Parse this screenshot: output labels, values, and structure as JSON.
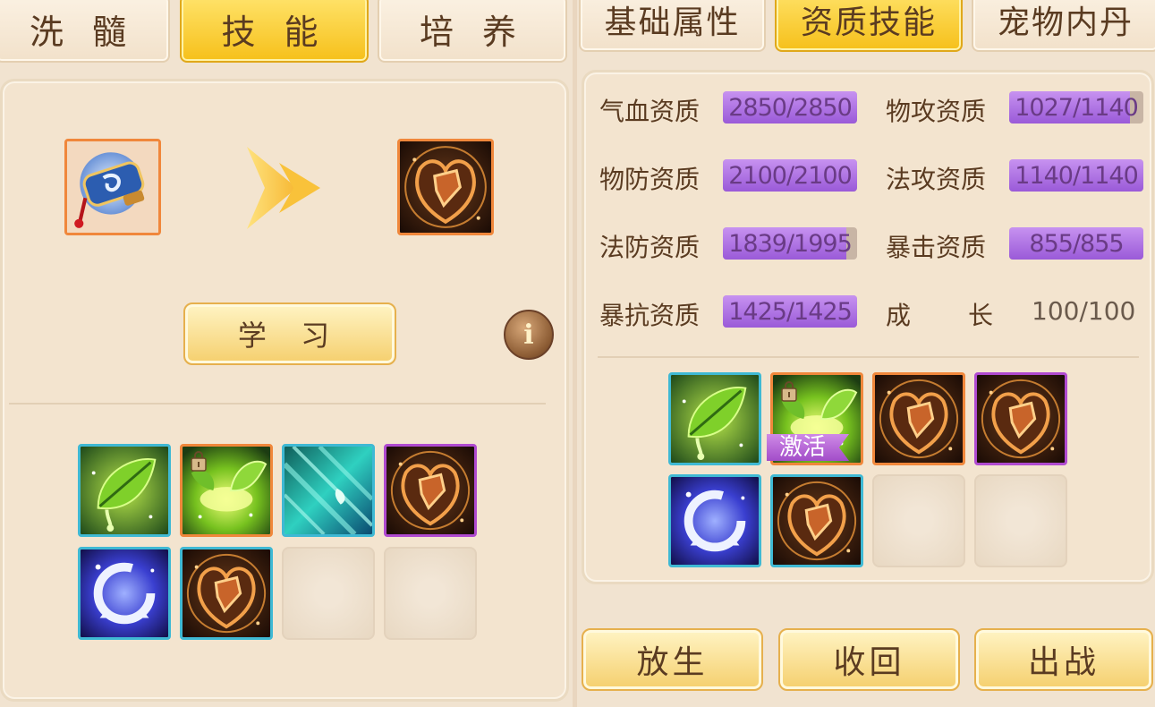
{
  "left_tabs": [
    "洗 髓",
    "技 能",
    "培 养"
  ],
  "left_active_tab": 1,
  "right_tabs": [
    "基础属性",
    "资质技能",
    "宠物内丹"
  ],
  "right_active_tab": 1,
  "learn": {
    "source_item_icon": "skill-book-scroll-icon",
    "arrow_icon": "arrow-right-icon",
    "target_skill_icon": "shield-rune-skill-icon",
    "button_label": "学 习",
    "info_label": "i"
  },
  "left_skills": [
    {
      "icon": "leaf-drop-skill-icon",
      "border": "cyan",
      "locked": false
    },
    {
      "icon": "glowing-leaf-skill-icon",
      "border": "orange",
      "locked": true
    },
    {
      "icon": "rain-skill-icon",
      "border": "cyan",
      "locked": false
    },
    {
      "icon": "shield-rune-skill-icon",
      "border": "purple",
      "locked": false
    },
    {
      "icon": "spiral-skill-icon",
      "border": "cyan",
      "locked": false
    },
    {
      "icon": "shield-rune-skill-icon",
      "border": "cyan",
      "locked": false
    }
  ],
  "aptitudes": [
    {
      "label": "气血资质",
      "value": "2850/2850",
      "fill": 1.0
    },
    {
      "label": "物攻资质",
      "value": "1027/1140",
      "fill": 0.9
    },
    {
      "label": "物防资质",
      "value": "2100/2100",
      "fill": 1.0
    },
    {
      "label": "法攻资质",
      "value": "1140/1140",
      "fill": 1.0
    },
    {
      "label": "法防资质",
      "value": "1839/1995",
      "fill": 0.92
    },
    {
      "label": "暴击资质",
      "value": "855/855",
      "fill": 1.0
    },
    {
      "label": "暴抗资质",
      "value": "1425/1425",
      "fill": 1.0
    }
  ],
  "growth": {
    "label_a": "成",
    "label_b": "长",
    "value": "100/100"
  },
  "right_skills": [
    {
      "icon": "leaf-drop-skill-icon",
      "border": "cyan",
      "locked": false
    },
    {
      "icon": "glowing-leaf-skill-icon",
      "border": "orange",
      "locked": true,
      "tag": "激活"
    },
    {
      "icon": "shield-rune-skill-icon",
      "border": "orange",
      "locked": false
    },
    {
      "icon": "shield-rune-skill-icon",
      "border": "purple",
      "locked": false
    },
    {
      "icon": "spiral-skill-icon",
      "border": "cyan",
      "locked": false
    },
    {
      "icon": "shield-rune-skill-icon",
      "border": "cyan",
      "locked": false
    }
  ],
  "actions": {
    "release": "放生",
    "recall": "收回",
    "deploy": "出战"
  }
}
